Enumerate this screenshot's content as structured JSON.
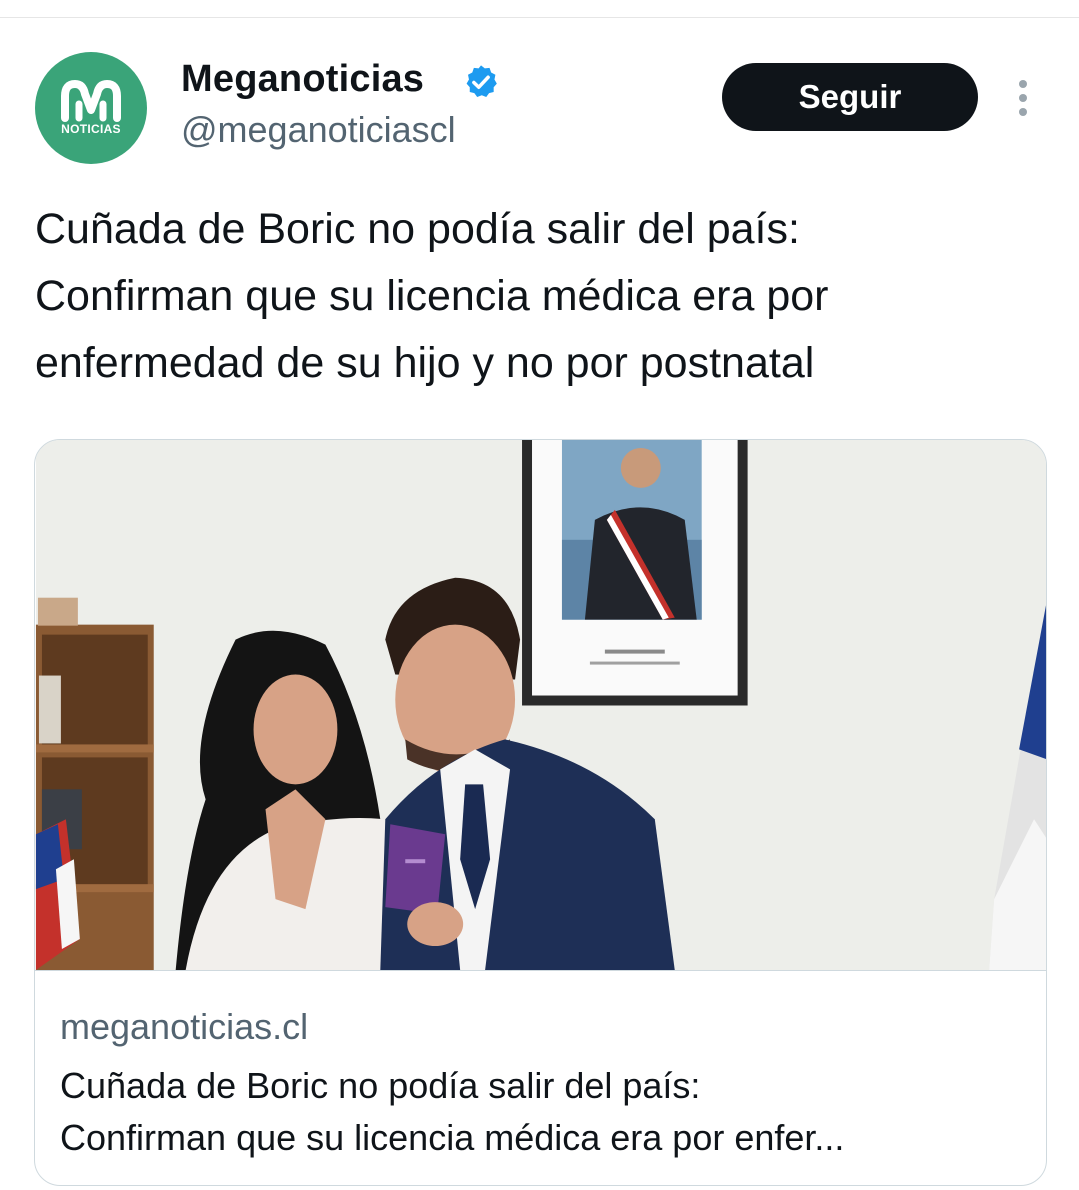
{
  "account": {
    "display_name": "Meganoticias",
    "handle": "@meganoticiascl",
    "verified": true,
    "avatar_text": "NOTICIAS",
    "avatar_color": "#3aa479"
  },
  "follow_button": {
    "label": "Seguir"
  },
  "more_icon": "vertical-ellipsis-icon",
  "tweet": {
    "lines": [
      "Cuñada de Boric no podía salir del país:",
      "Confirman que su licencia médica era por",
      "enfermedad de su hijo y no por postnatal"
    ]
  },
  "card": {
    "domain": "meganoticias.cl",
    "title_lines": [
      "Cuñada de Boric no podía salir del país:",
      "Confirman que su licencia médica era por enfer..."
    ]
  },
  "colors": {
    "text_primary": "#0f1419",
    "text_secondary": "#536471",
    "verified_blue": "#1d9bf0",
    "border": "#cfd9de"
  }
}
